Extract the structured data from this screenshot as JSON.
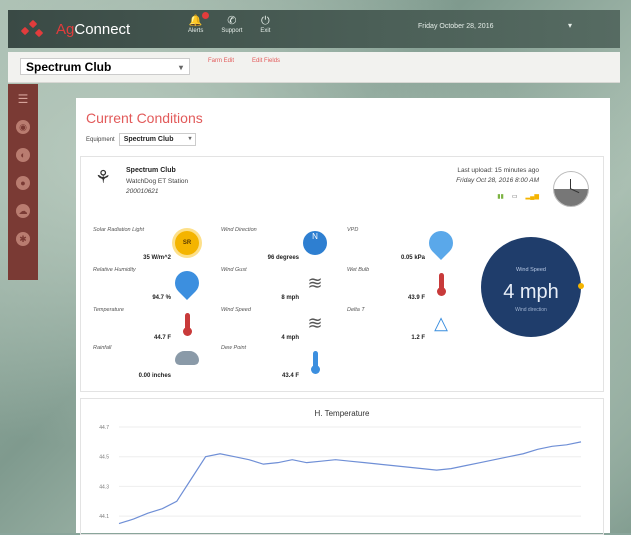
{
  "app": {
    "brand_accent": "Ag",
    "brand_rest": "Connect",
    "datetime": "Friday October 28, 2016"
  },
  "topbar": {
    "items": [
      {
        "icon": "bell-icon",
        "label": "Alerts"
      },
      {
        "icon": "phone-icon",
        "label": "Support"
      },
      {
        "icon": "exit-icon",
        "label": "Exit"
      }
    ]
  },
  "sitebar": {
    "site": "Spectrum Club",
    "link1": "Farm Edit",
    "link2": "Edit Fields"
  },
  "main": {
    "title": "Current Conditions",
    "equipment_label": "Equipment",
    "equipment_value": "Spectrum Club"
  },
  "station": {
    "name": "Spectrum Club",
    "model": "WatchDog ET Station",
    "id": "200010621",
    "last_upload": "Last upload: 15 minutes ago",
    "upload_time": "Friday Oct 28, 2016 8:00 AM",
    "status_colors": {
      "battery": "#7cb342",
      "signal": "#f4b400"
    }
  },
  "metrics": {
    "solar_label": "Solar Radiation Light",
    "solar_value": "35 W/m^2",
    "solar_icon_text": "SR",
    "rh_label": "Relative Humidity",
    "rh_value": "94.7 %",
    "temp_label": "Temperature",
    "temp_value": "44.7 F",
    "rain_label": "Rainfall",
    "rain_value": "0.00 inches",
    "wdir_label": "Wind Direction",
    "wdir_value": "96 degrees",
    "wdir_icon_text": "N",
    "gust_label": "Wind Gust",
    "gust_value": "8 mph",
    "wspeed_label": "Wind Speed",
    "wspeed_value": "4 mph",
    "dew_label": "Dew Point",
    "dew_value": "43.4 F",
    "vpd_label": "VPD",
    "vpd_value": "0.05 kPa",
    "wetbulb_label": "Wet Bulb",
    "wetbulb_value": "43.9 F",
    "deltat_label": "Delta T",
    "deltat_value": "1.2 F"
  },
  "wind_gauge": {
    "label": "Wind Speed",
    "value": "4 mph",
    "sub": "Wind direction"
  },
  "chart": {
    "title": "H. Temperature",
    "y_ticks": [
      "44.7",
      "44.5",
      "44.3",
      "44.1"
    ],
    "color": "#6f8fd6"
  },
  "chart_data": {
    "type": "line",
    "title": "H. Temperature",
    "y": [
      44.05,
      44.08,
      44.12,
      44.15,
      44.2,
      44.35,
      44.5,
      44.52,
      44.5,
      44.48,
      44.45,
      44.46,
      44.48,
      44.46,
      44.47,
      44.48,
      44.47,
      44.46,
      44.45,
      44.44,
      44.43,
      44.42,
      44.41,
      44.42,
      44.44,
      44.46,
      44.48,
      44.5,
      44.52,
      44.55,
      44.57,
      44.58,
      44.6
    ],
    "ylim": [
      44.0,
      44.7
    ]
  }
}
